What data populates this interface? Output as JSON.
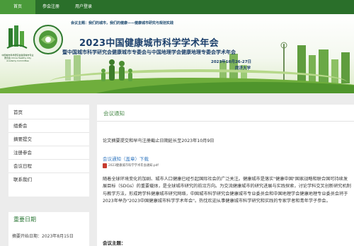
{
  "nav": {
    "tabs": [
      {
        "label": "首页"
      },
      {
        "label": "参会注册"
      },
      {
        "label": "用户登录"
      }
    ]
  },
  "banner": {
    "slogan_label": "会议主题：",
    "slogan_text": "我们的城市，我们的健康——健康城市研究与规划实践",
    "title": "2023中国健康城市科学学术年会",
    "subtitle": "暨中国城市科学研究会健康城市专委会与中国地理学会健康地理专委会学术年会",
    "date": "2023年10月26-27日",
    "venue": "同济大学",
    "logo_a_text": "中国城市科学研究会健康城市专业委员会 China Healthy City Academy Committee"
  },
  "sidebar": {
    "items": [
      {
        "label": "首页"
      },
      {
        "label": "组委会"
      },
      {
        "label": "摘要提交"
      },
      {
        "label": "注册参会"
      },
      {
        "label": "会议日程"
      },
      {
        "label": "联系我们"
      }
    ]
  },
  "dates": {
    "title": "重要日期",
    "line": "摘要开始日期：2023年8月15日"
  },
  "main": {
    "title": "会议通知",
    "notice": "论文摘要提交和早鸟注册截止日期延长至2023年10月9日",
    "attachment_label": "会议通知（盖章）下载",
    "file_name": "2023健康城市科学学术年会通知.pdf",
    "body": "随着全球环境变化的加剧、城市人口健康已经引起国际社会的广泛关注。健康城市是落实\"健康中国\"国家战略和联合国可持续发展目标（SDGs）的重要载体，是全球城市研究的前沿方向。为交流健康城市的研究进展与实践探索，讨论学科交叉创新研究机制与教学方法，形成跨学科健康城市研究网络，中国城市科学研究会健康城市专业委员会和中国地理学会健康地理专业委员会将于2023年举办\"2023中国健康城市科学学术年会\"。热忱欢迎从事健康城市科学研究和实践的专家学者和青年学子参会。",
    "summary_label": "会议主题："
  }
}
